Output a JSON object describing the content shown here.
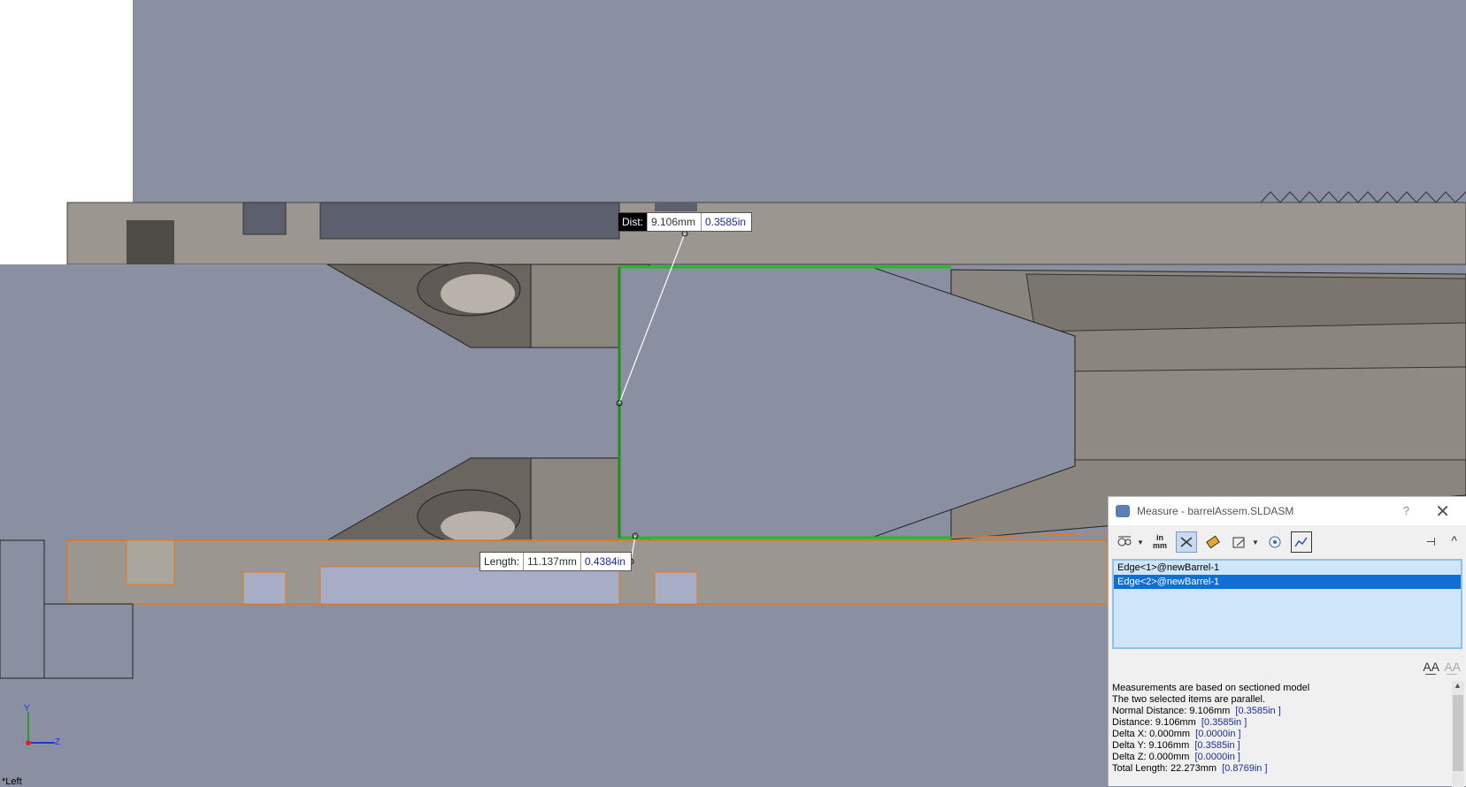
{
  "viewport": {
    "view_name": "*Left",
    "triad": {
      "y_label": "Y",
      "z_label": "Z"
    }
  },
  "dist_callout": {
    "label": "Dist:",
    "mm": "9.106mm",
    "inch": "0.3585in"
  },
  "length_callout": {
    "label": "Length:",
    "mm": "11.137mm",
    "inch": "0.4384in"
  },
  "measure": {
    "title": "Measure - barrelAssem.SLDASM",
    "help": "?",
    "close": "✕",
    "toolbar": {
      "units": "in mm",
      "pin": "⊣",
      "collapse": "^"
    },
    "selections": [
      {
        "label": "Edge<1>@newBarrel-1",
        "selected": false
      },
      {
        "label": "Edge<2>@newBarrel-1",
        "selected": true
      }
    ],
    "results": {
      "line1": "Measurements are based on sectioned model",
      "line2": "The two selected items are parallel.",
      "normal_distance": {
        "label": "Normal Distance: 9.106mm",
        "inch": "[0.3585in ]"
      },
      "distance": {
        "label": "Distance: 9.106mm",
        "inch": "[0.3585in ]"
      },
      "delta_x": {
        "label": "Delta X: 0.000mm",
        "inch": "[0.0000in ]"
      },
      "delta_y": {
        "label": "Delta Y: 9.106mm",
        "inch": "[0.3585in ]"
      },
      "delta_z": {
        "label": "Delta Z: 0.000mm",
        "inch": "[0.0000in ]"
      },
      "total_length": {
        "label": "Total Length: 22.273mm",
        "inch": "[0.8769in ]"
      }
    }
  },
  "colors": {
    "background": "#8a8fa2",
    "section": "#9b9690",
    "highlight_edge": "#22bb22",
    "selected_edge": "#e07a20"
  }
}
